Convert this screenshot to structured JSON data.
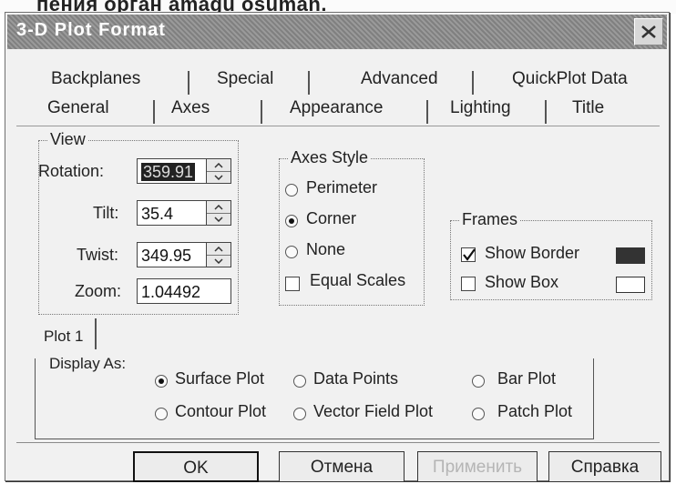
{
  "caption": {
    "text": "пения орган amagu osuman."
  },
  "window": {
    "title": "3-D Plot Format"
  },
  "tabs": {
    "row1": [
      "Backplanes",
      "Special",
      "Advanced",
      "QuickPlot Data"
    ],
    "row2": [
      "General",
      "Axes",
      "Appearance",
      "Lighting",
      "Title"
    ]
  },
  "view": {
    "title": "View",
    "rotation": {
      "label": "Rotation:",
      "value": "359.91"
    },
    "tilt": {
      "label": "Tilt:",
      "value": "35.4"
    },
    "twist": {
      "label": "Twist:",
      "value": "349.95"
    },
    "zoom": {
      "label": "Zoom:",
      "value": "1.04492"
    }
  },
  "axes_style": {
    "title": "Axes Style",
    "options": [
      "Perimeter",
      "Corner",
      "None"
    ],
    "selected": "Corner",
    "equal_scales": {
      "label": "Equal Scales",
      "checked": false
    }
  },
  "frames": {
    "title": "Frames",
    "show_border": {
      "label": "Show Border",
      "checked": true,
      "color": "#333333"
    },
    "show_box": {
      "label": "Show Box",
      "checked": false,
      "color": "#ffffff"
    }
  },
  "plot": {
    "tab": "Plot 1",
    "display_as_label": "Display As:",
    "options": [
      "Surface Plot",
      "Data Points",
      "Bar Plot",
      "Contour Plot",
      "Vector Field Plot",
      "Patch Plot"
    ],
    "selected": "Surface Plot"
  },
  "buttons": {
    "ok": "OK",
    "cancel": "Отмена",
    "apply": "Применить",
    "help": "Справка"
  }
}
